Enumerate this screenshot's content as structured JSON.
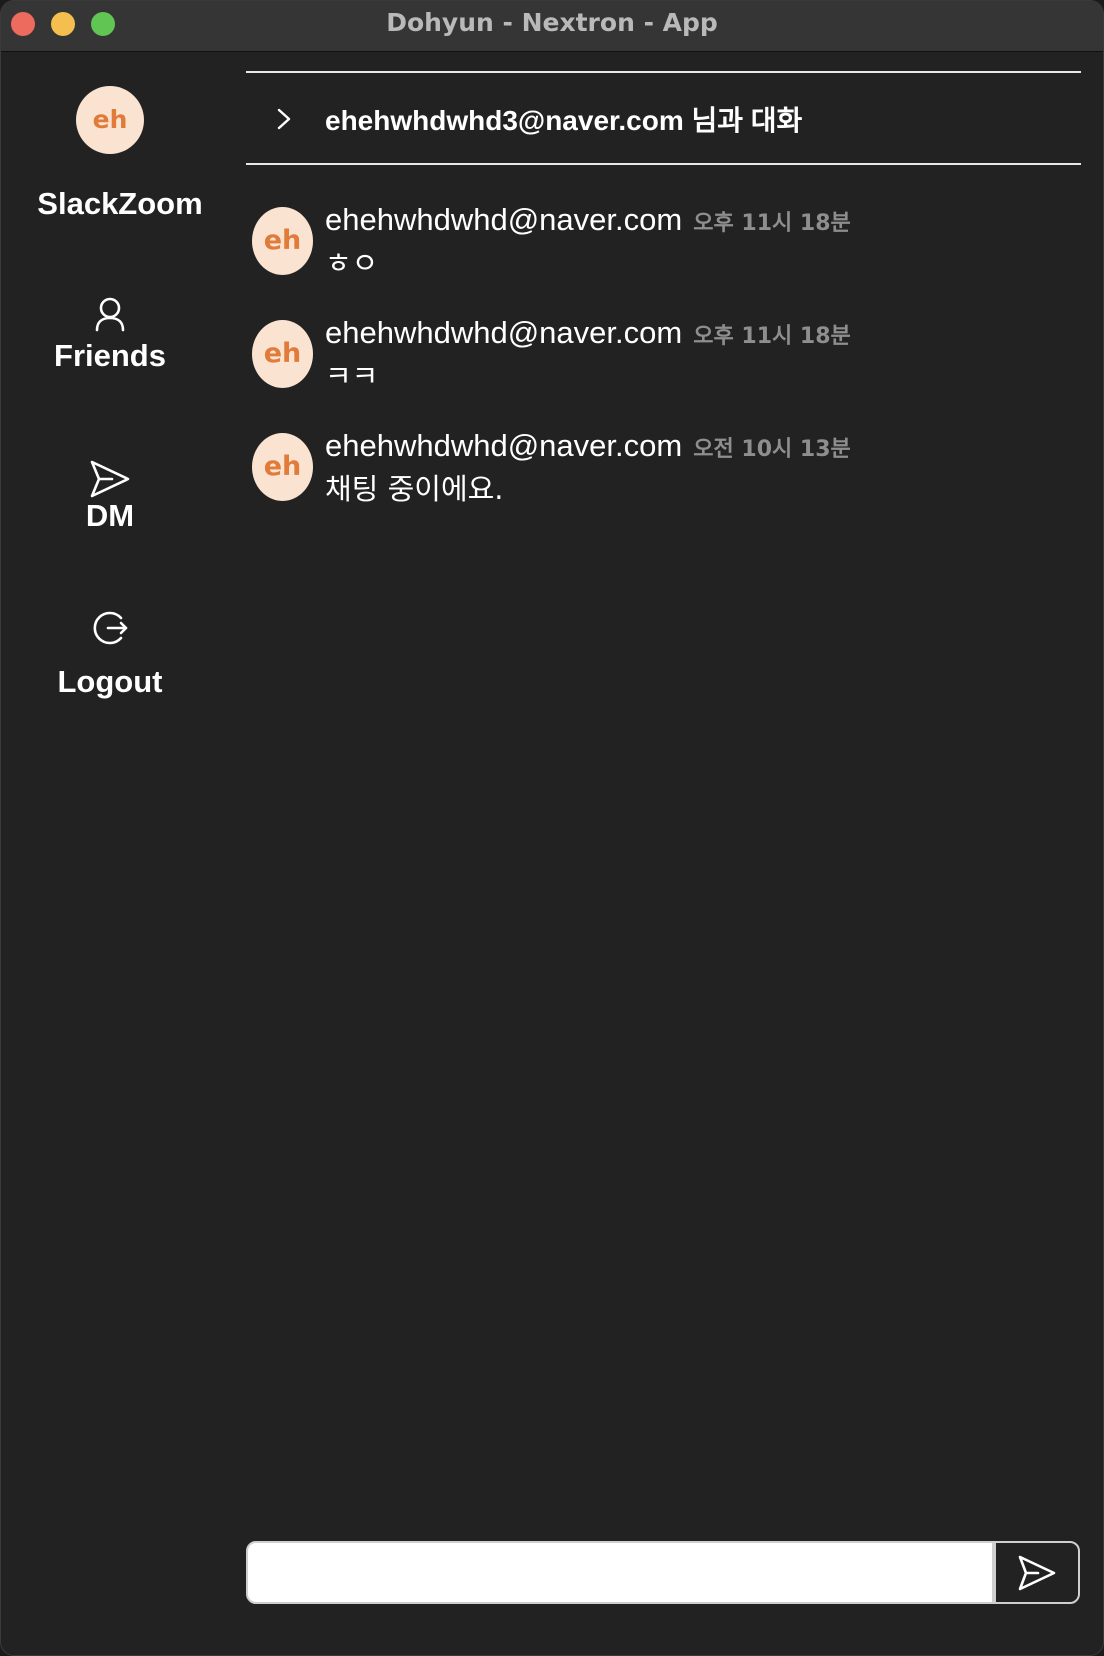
{
  "window": {
    "title": "Dohyun - Nextron - App"
  },
  "sidebar": {
    "avatar_initials": "eh",
    "brand": "SlackZoom",
    "items": [
      {
        "label": "Friends",
        "icon": "user-icon"
      },
      {
        "label": "DM",
        "icon": "send-icon"
      },
      {
        "label": "Logout",
        "icon": "logout-icon"
      }
    ]
  },
  "chat": {
    "header_title": "ehehwhdwhd3@naver.com 님과 대화",
    "messages": [
      {
        "avatar": "eh",
        "sender": "ehehwhdwhd@naver.com",
        "time": "오후 11시 18분",
        "text": "ㅎㅇ"
      },
      {
        "avatar": "eh",
        "sender": "ehehwhdwhd@naver.com",
        "time": "오후 11시 18분",
        "text": "ㅋㅋ"
      },
      {
        "avatar": "eh",
        "sender": "ehehwhdwhd@naver.com",
        "time": "오전 10시 13분",
        "text": "채팅 중이에요."
      }
    ],
    "input_value": ""
  },
  "colors": {
    "background": "#222222",
    "avatar_bg": "#fae3d1",
    "avatar_text": "#e07b39",
    "time_text": "#8e8e8e"
  }
}
